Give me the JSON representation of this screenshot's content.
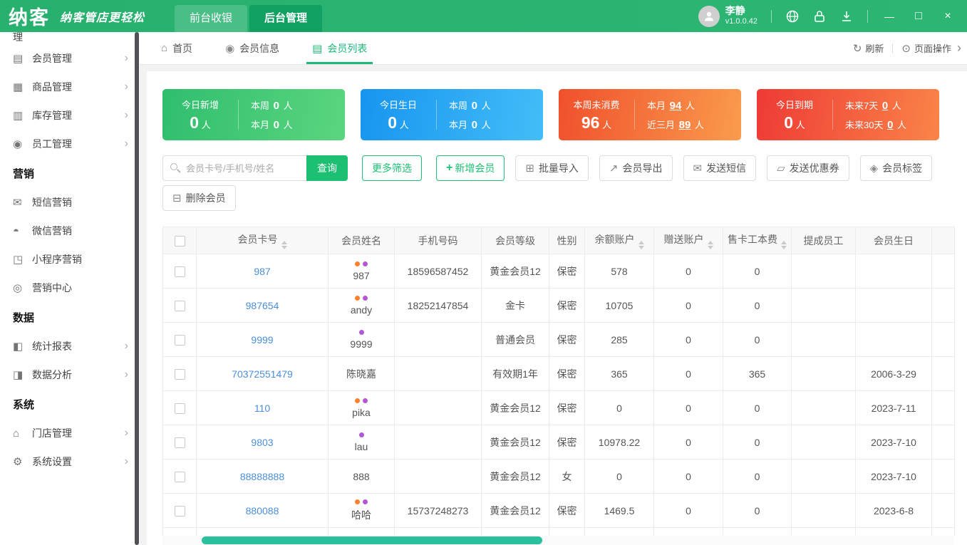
{
  "colors": {
    "primary": "#1dbf73",
    "link": "#4a8fdd",
    "tag_orange": "#ff7f2a",
    "tag_purple": "#b356d6",
    "scroll_thumb": "#2ac09e"
  },
  "topbar": {
    "logo": "纳客",
    "slogan": "纳客管店更轻松",
    "nav_tabs": [
      {
        "name": "front-cashier",
        "label": "前台收银",
        "active": false
      },
      {
        "name": "backend-admin",
        "label": "后台管理",
        "active": true
      }
    ],
    "user": {
      "name": "李静",
      "version": "v1.0.0.42"
    },
    "window_controls": {
      "minimize": "—",
      "maximize": "□",
      "close": "×"
    }
  },
  "sidebar": {
    "partial_top": "理",
    "items": [
      {
        "name": "member-management",
        "label": "会员管理",
        "icon": "▤",
        "icon_name": "member-icon",
        "arrow": true
      },
      {
        "name": "product-management",
        "label": "商品管理",
        "icon": "▦",
        "icon_name": "product-icon",
        "arrow": true
      },
      {
        "name": "inventory-management",
        "label": "库存管理",
        "icon": "▥",
        "icon_name": "inventory-icon",
        "arrow": true
      },
      {
        "name": "staff-management",
        "label": "员工管理",
        "icon": "◉",
        "icon_name": "staff-icon",
        "arrow": true
      },
      {
        "name": "marketing-section",
        "label": "营销",
        "type": "section"
      },
      {
        "name": "sms-marketing",
        "label": "短信营销",
        "icon": "✉",
        "icon_name": "sms-icon",
        "arrow": false
      },
      {
        "name": "wechat-marketing",
        "label": "微信营销",
        "icon": "◓",
        "icon_name": "wechat-icon",
        "arrow": false
      },
      {
        "name": "miniapp-marketing",
        "label": "小程序营销",
        "icon": "◳",
        "icon_name": "miniapp-icon",
        "arrow": false
      },
      {
        "name": "marketing-center",
        "label": "营销中心",
        "icon": "◎",
        "icon_name": "marketing-center-icon",
        "arrow": false
      },
      {
        "name": "data-section",
        "label": "数据",
        "type": "section"
      },
      {
        "name": "statistics-report",
        "label": "统计报表",
        "icon": "◧",
        "icon_name": "report-icon",
        "arrow": true
      },
      {
        "name": "data-analysis",
        "label": "数据分析",
        "icon": "◨",
        "icon_name": "analysis-icon",
        "arrow": true
      },
      {
        "name": "system-section",
        "label": "系统",
        "type": "section"
      },
      {
        "name": "store-management",
        "label": "门店管理",
        "icon": "⌂",
        "icon_name": "store-icon",
        "arrow": true
      },
      {
        "name": "system-settings",
        "label": "系统设置",
        "icon": "⚙",
        "icon_name": "settings-icon",
        "arrow": true
      }
    ]
  },
  "tabbar": {
    "tabs": [
      {
        "name": "tab-home",
        "label": "首页",
        "icon": "⌂",
        "icon_name": "home-icon",
        "active": false
      },
      {
        "name": "tab-member-info",
        "label": "会员信息",
        "icon": "◉",
        "icon_name": "members-icon",
        "active": false
      },
      {
        "name": "tab-member-list",
        "label": "会员列表",
        "icon": "▤",
        "icon_name": "list-icon",
        "active": true
      }
    ],
    "refresh_label": "刷新",
    "refresh_icon": "↻",
    "page_ops_label": "页面操作",
    "page_ops_icon": "⊙",
    "chevron": "›"
  },
  "stat_cards": [
    {
      "name": "stat-card-new-today",
      "title": "今日新增",
      "value": "0",
      "unit": "人",
      "gradient": [
        "#2fbe6e",
        "#5bd57f"
      ],
      "rows": [
        {
          "label": "本周",
          "value": "0",
          "unit": "人",
          "link": false
        },
        {
          "label": "本月",
          "value": "0",
          "unit": "人",
          "link": false
        }
      ]
    },
    {
      "name": "stat-card-birthday-today",
      "title": "今日生日",
      "value": "0",
      "unit": "人",
      "gradient": [
        "#1795ef",
        "#43bdf8"
      ],
      "rows": [
        {
          "label": "本周",
          "value": "0",
          "unit": "人",
          "link": false
        },
        {
          "label": "本月",
          "value": "0",
          "unit": "人",
          "link": false
        }
      ]
    },
    {
      "name": "stat-card-no-consume-week",
      "title": "本周未消费",
      "value": "96",
      "unit": "人",
      "gradient": [
        "#f0502c",
        "#fa9b4d"
      ],
      "rows": [
        {
          "label": "本月",
          "value": "94",
          "unit": "人",
          "link": true
        },
        {
          "label": "近三月",
          "value": "89",
          "unit": "人",
          "link": true
        }
      ]
    },
    {
      "name": "stat-card-expire-today",
      "title": "今日到期",
      "value": "0",
      "unit": "人",
      "gradient": [
        "#ee3a35",
        "#fa8448"
      ],
      "rows": [
        {
          "label": "未来7天",
          "value": "0",
          "unit": "人",
          "link": true
        },
        {
          "label": "未来30天",
          "value": "0",
          "unit": "人",
          "link": true
        }
      ]
    }
  ],
  "toolbar": {
    "search_placeholder": "会员卡号/手机号/姓名",
    "query": "查询",
    "more_filter": "更多筛选",
    "add_plus": "+",
    "add_member": "新增会员",
    "gray_buttons": [
      {
        "name": "batch-import-button",
        "label": "批量导入",
        "icon": "⊞",
        "icon_name": "import-icon"
      },
      {
        "name": "export-member-button",
        "label": "会员导出",
        "icon": "↗",
        "icon_name": "export-icon"
      },
      {
        "name": "send-sms-button",
        "label": "发送短信",
        "icon": "✉",
        "icon_name": "sms-icon"
      },
      {
        "name": "send-coupon-button",
        "label": "发送优惠券",
        "icon": "▱",
        "icon_name": "coupon-icon"
      },
      {
        "name": "member-tag-button",
        "label": "会员标签",
        "icon": "◈",
        "icon_name": "tag-icon"
      }
    ],
    "delete_member": "删除会员",
    "delete_icon": "⊟"
  },
  "table": {
    "columns": [
      {
        "name": "card",
        "label": "会员卡号",
        "sortable": true
      },
      {
        "name": "name",
        "label": "会员姓名",
        "sortable": false
      },
      {
        "name": "phone",
        "label": "手机号码",
        "sortable": false
      },
      {
        "name": "level",
        "label": "会员等级",
        "sortable": false
      },
      {
        "name": "gender",
        "label": "性别",
        "sortable": false
      },
      {
        "name": "balance",
        "label": "余额账户",
        "sortable": true
      },
      {
        "name": "gift",
        "label": "赠送账户",
        "sortable": true
      },
      {
        "name": "fee",
        "label": "售卡工本费",
        "sortable": true
      },
      {
        "name": "staff",
        "label": "提成员工",
        "sortable": false
      },
      {
        "name": "birthday",
        "label": "会员生日",
        "sortable": false
      }
    ],
    "rows": [
      {
        "card": "987",
        "name": "987",
        "tags": [
          "orange",
          "purple"
        ],
        "phone": "18596587452",
        "level": "黄金会员12",
        "gender": "保密",
        "balance": "578",
        "gift": "0",
        "fee": "0",
        "staff": "",
        "birthday": ""
      },
      {
        "card": "987654",
        "name": "andy",
        "tags": [
          "orange",
          "purple"
        ],
        "phone": "18252147854",
        "level": "金卡",
        "gender": "保密",
        "balance": "10705",
        "gift": "0",
        "fee": "0",
        "staff": "",
        "birthday": ""
      },
      {
        "card": "9999",
        "name": "9999",
        "tags": [
          "purple"
        ],
        "phone": "",
        "level": "普通会员",
        "gender": "保密",
        "balance": "285",
        "gift": "0",
        "fee": "0",
        "staff": "",
        "birthday": ""
      },
      {
        "card": "70372551479",
        "name": "陈晓嘉",
        "tags": [],
        "phone": "",
        "level": "有效期1年",
        "gender": "保密",
        "balance": "365",
        "gift": "0",
        "fee": "365",
        "staff": "",
        "birthday": "2006-3-29"
      },
      {
        "card": "110",
        "name": "pika",
        "tags": [
          "orange",
          "purple"
        ],
        "phone": "",
        "level": "黄金会员12",
        "gender": "保密",
        "balance": "0",
        "gift": "0",
        "fee": "0",
        "staff": "",
        "birthday": "2023-7-11"
      },
      {
        "card": "9803",
        "name": "lau",
        "tags": [
          "purple"
        ],
        "phone": "",
        "level": "黄金会员12",
        "gender": "保密",
        "balance": "10978.22",
        "gift": "0",
        "fee": "0",
        "staff": "",
        "birthday": "2023-7-10"
      },
      {
        "card": "88888888",
        "name": "888",
        "tags": [],
        "phone": "",
        "level": "黄金会员12",
        "gender": "女",
        "balance": "0",
        "gift": "0",
        "fee": "0",
        "staff": "",
        "birthday": "2023-7-10"
      },
      {
        "card": "880088",
        "name": "哈哈",
        "tags": [
          "orange",
          "purple"
        ],
        "phone": "15737248273",
        "level": "黄金会员12",
        "gender": "保密",
        "balance": "1469.5",
        "gift": "0",
        "fee": "0",
        "staff": "",
        "birthday": "2023-6-8"
      }
    ]
  }
}
